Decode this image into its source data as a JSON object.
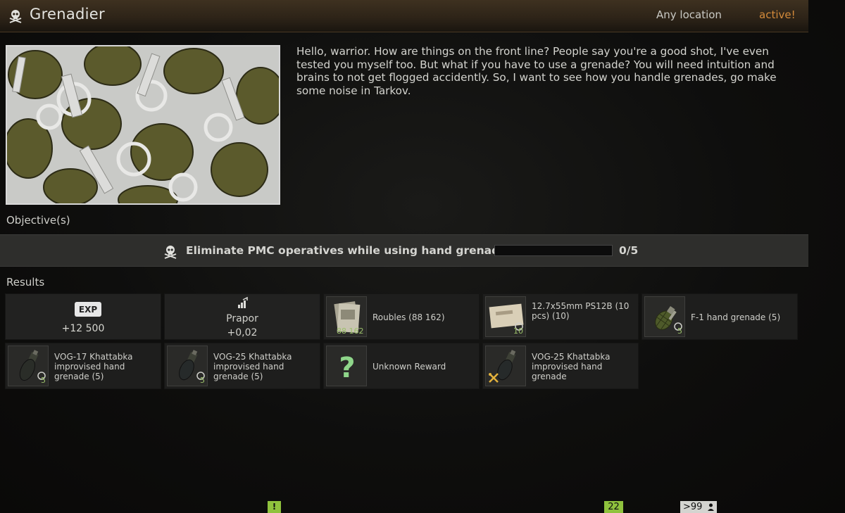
{
  "header": {
    "title": "Grenadier",
    "location": "Any location",
    "status": "active!"
  },
  "description": "Hello, warrior. How are things on the front line? People say you're a good shot, I've even tested you myself too. But what if you have to use a grenade? You will need intuition and brains to not get flogged accidently. So, I want to see how you handle grenades, go make some noise in Tarkov.",
  "objectives": {
    "label": "Objective(s)",
    "items": [
      {
        "text": "Eliminate PMC operatives while using hand grenades",
        "progress": "0/5",
        "fraction": 0.0
      }
    ]
  },
  "results": {
    "label": "Results",
    "exp": {
      "badge": "EXP",
      "value": "+12 500"
    },
    "trader": {
      "name": "Prapor",
      "value": "+0,02"
    },
    "items": [
      {
        "label": "Roubles (88 162)",
        "count": "88 162"
      },
      {
        "label": "12.7x55mm PS12B (10 pcs) (10)",
        "count": "10"
      },
      {
        "label": "F-1 hand grenade (5)",
        "count": "5"
      },
      {
        "label": "VOG-17 Khattabka improvised hand grenade (5)",
        "count": "5"
      },
      {
        "label": "VOG-25 Khattabka improvised hand grenade (5)",
        "count": "5"
      },
      {
        "label": "Unknown Reward",
        "count": ""
      },
      {
        "label": "VOG-25 Khattabka improvised hand grenade",
        "count": ""
      }
    ]
  },
  "bottom": {
    "alert": "!",
    "count": "22",
    "online": ">99"
  },
  "colors": {
    "status": "#d38a3a",
    "accent_green": "#8fc23d",
    "count_green": "#9bc06a"
  },
  "icons": {
    "header": "skull-icon",
    "objective": "skull-icon",
    "trader": "rep-increase-icon",
    "unknown": "question-mark-icon",
    "craft": "crossed-tools-icon",
    "player": "person-icon"
  }
}
